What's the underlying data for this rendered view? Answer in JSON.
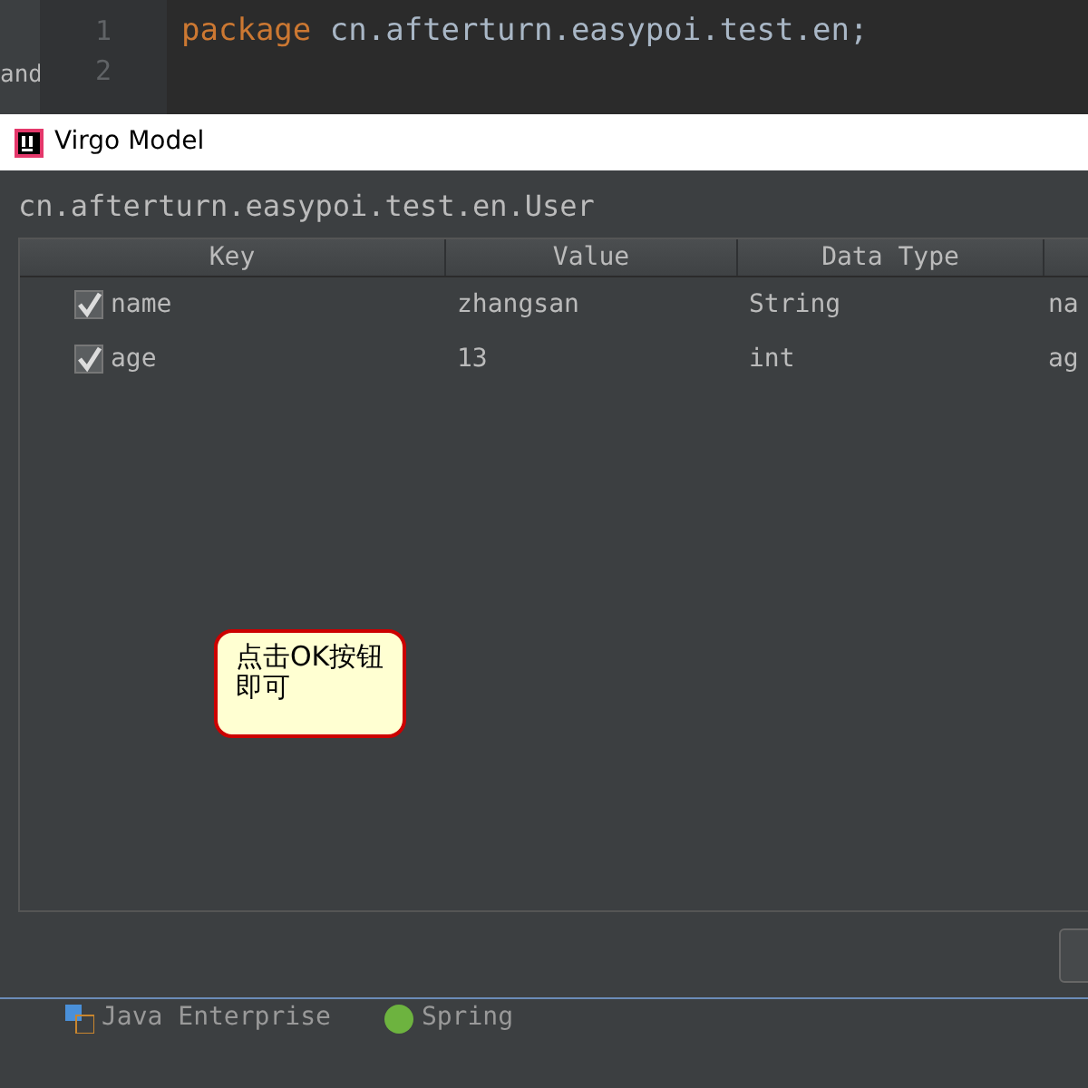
{
  "editor": {
    "side_label": "and",
    "lines": [
      {
        "number": "1",
        "keyword": "package",
        "code": " cn.afterturn.easypoi.test.en;"
      },
      {
        "number": "2"
      }
    ]
  },
  "dialog": {
    "title": "Virgo Model",
    "class_name": "cn.afterturn.easypoi.test.en.User",
    "table": {
      "columns": [
        "Key",
        "Value",
        "Data Type"
      ],
      "rows": [
        {
          "checked": true,
          "key": "name",
          "value": "zhangsan",
          "data_type": "String",
          "column_4": "na"
        },
        {
          "checked": true,
          "key": "age",
          "value": "13",
          "data_type": "int",
          "column_4": "ag"
        }
      ]
    },
    "callout": "点击OK按钮即可"
  },
  "tool_windows": [
    {
      "label": "Java Enterprise",
      "kind": "enterprise"
    },
    {
      "label": "Spring",
      "kind": "spring"
    }
  ]
}
